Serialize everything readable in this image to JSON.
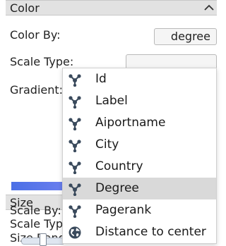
{
  "color_section": {
    "title": "Color",
    "color_by_label": "Color By:",
    "color_by_value": "degree",
    "scale_type_label": "Scale Type:",
    "gradient_label": "Gradient:"
  },
  "size_section": {
    "title": "Size",
    "scale_by_label": "Scale By:",
    "scale_type_label": "Scale Type:",
    "size_range_label": "Size Range:"
  },
  "dropdown": {
    "selected": "Degree",
    "options": [
      {
        "label": "Id",
        "icon": "network-icon"
      },
      {
        "label": "Label",
        "icon": "network-icon"
      },
      {
        "label": "Aiportname",
        "icon": "network-icon"
      },
      {
        "label": "City",
        "icon": "network-icon"
      },
      {
        "label": "Country",
        "icon": "network-icon"
      },
      {
        "label": "Degree",
        "icon": "network-icon"
      },
      {
        "label": "Pagerank",
        "icon": "network-icon"
      },
      {
        "label": "Distance to center",
        "icon": "globe-icon"
      }
    ]
  },
  "colors": {
    "header_bg": "#e2e2e2",
    "icon_color": "#3a4a5c",
    "gradient_start": "#4b6fe6",
    "gradient_end": "#6d80ef",
    "selected_bg": "#d9d9d9"
  }
}
